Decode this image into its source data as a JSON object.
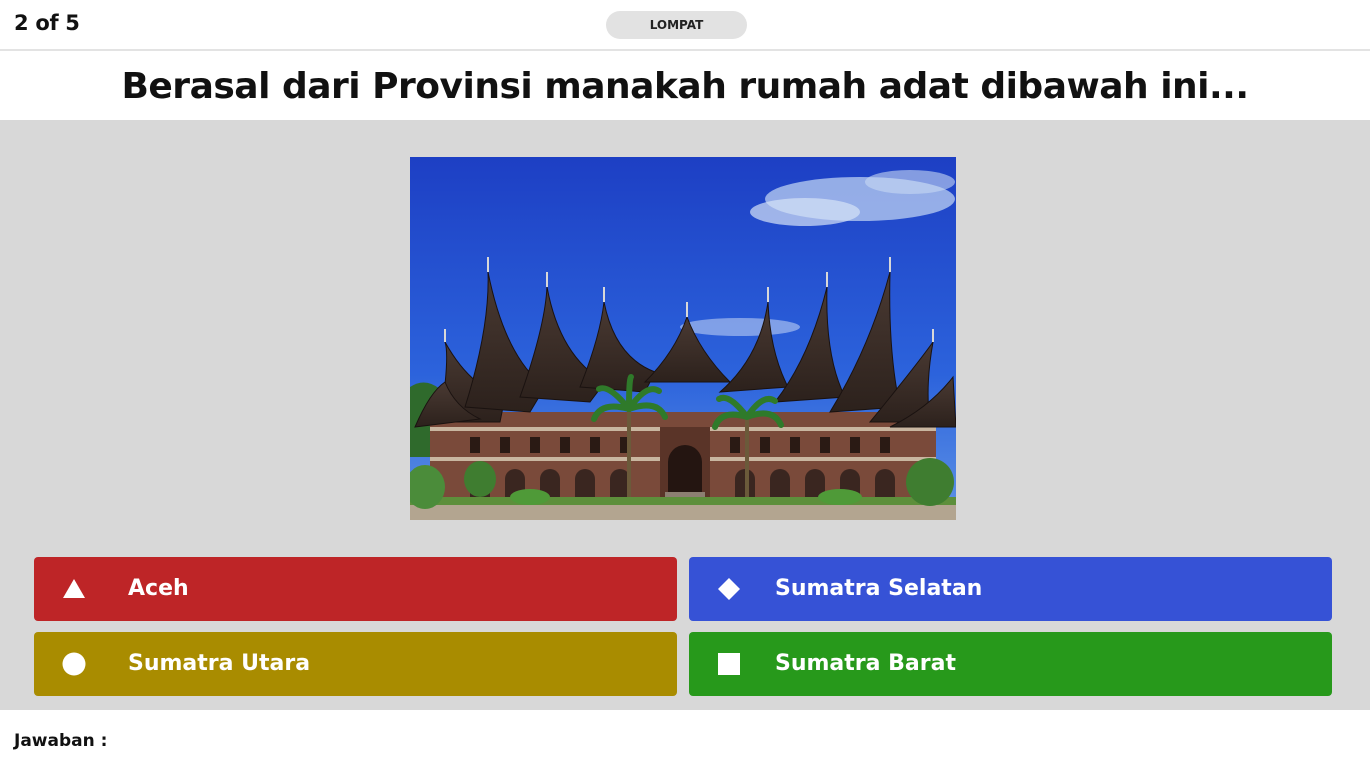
{
  "header": {
    "progress": "2 of 5",
    "skip_label": "LOMPAT"
  },
  "question": {
    "text": "Berasal dari Provinsi manakah rumah adat dibawah ini..."
  },
  "image": {
    "subject": "rumah-gadang-photo"
  },
  "answers": [
    {
      "label": "Aceh",
      "shape": "triangle-icon",
      "color": "#be2527"
    },
    {
      "label": "Sumatra Selatan",
      "shape": "diamond-icon",
      "color": "#3652d6"
    },
    {
      "label": "Sumatra Utara",
      "shape": "circle-icon",
      "color": "#a98c00"
    },
    {
      "label": "Sumatra Barat",
      "shape": "square-icon",
      "color": "#27991b"
    }
  ],
  "footer": {
    "answer_prompt": "Jawaban :"
  }
}
